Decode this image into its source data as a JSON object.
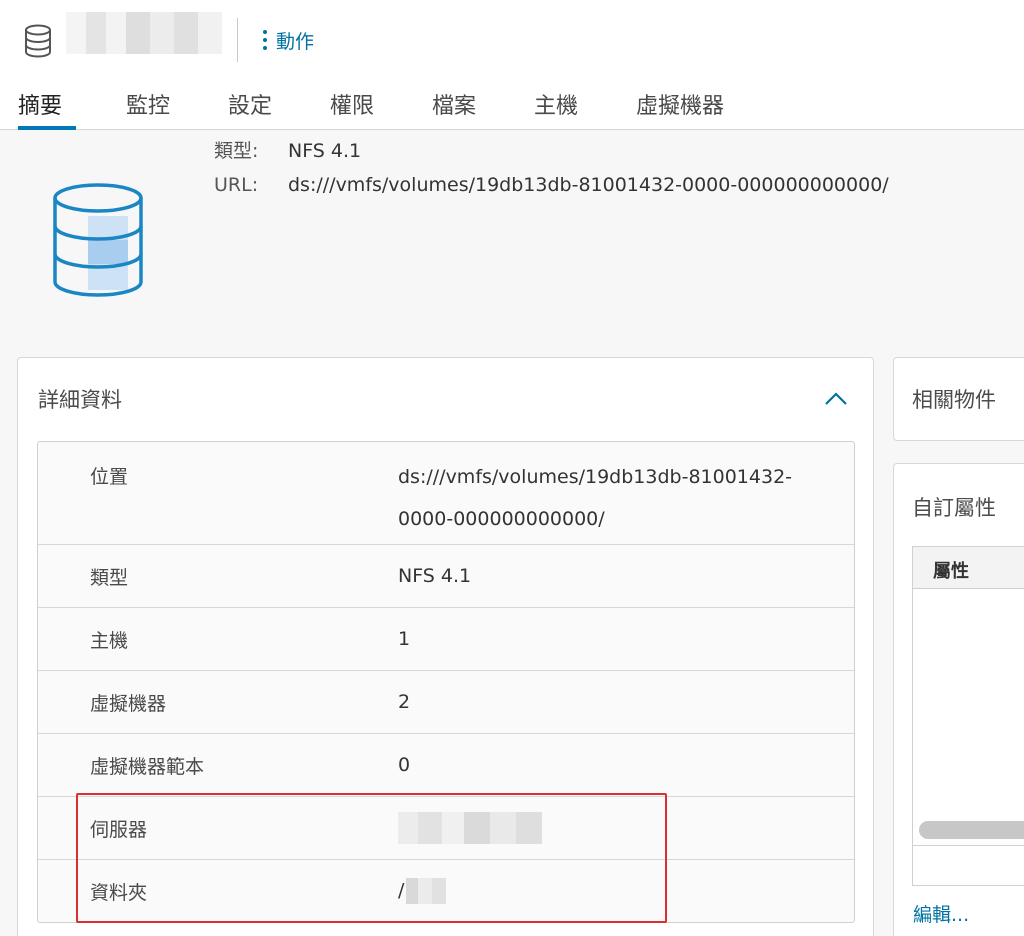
{
  "header": {
    "actions_label": "動作",
    "tabs": [
      {
        "label": "摘要",
        "active": true
      },
      {
        "label": "監控"
      },
      {
        "label": "設定"
      },
      {
        "label": "權限"
      },
      {
        "label": "檔案"
      },
      {
        "label": "主機"
      },
      {
        "label": "虛擬機器"
      }
    ]
  },
  "summary": {
    "type_label": "類型:",
    "type_value": "NFS 4.1",
    "url_label": "URL:",
    "url_value": "ds:///vmfs/volumes/19db13db-81001432-0000-000000000000/"
  },
  "details": {
    "title": "詳細資料",
    "rows": [
      {
        "key": "位置",
        "value_line1": "ds:///vmfs/volumes/19db13db-81001432-",
        "value_line2": "0000-000000000000/"
      },
      {
        "key": "類型",
        "value": "NFS 4.1"
      },
      {
        "key": "主機",
        "value": "1"
      },
      {
        "key": "虛擬機器",
        "value": "2"
      },
      {
        "key": "虛擬機器範本",
        "value": "0"
      },
      {
        "key": "伺服器",
        "value": ""
      },
      {
        "key": "資料夾",
        "value": "/"
      }
    ]
  },
  "related": {
    "title": "相關物件"
  },
  "custom_attributes": {
    "title": "自訂屬性",
    "column_header": "屬性",
    "edit_label": "編輯..."
  },
  "colors": {
    "accent": "#0079b8",
    "link": "#0072a3",
    "highlight": "#d9302f"
  },
  "icons": {
    "header": "database-icon",
    "actions": "vertical-ellipsis-icon",
    "summary": "datastore-icon",
    "collapse": "chevron-up-icon"
  }
}
